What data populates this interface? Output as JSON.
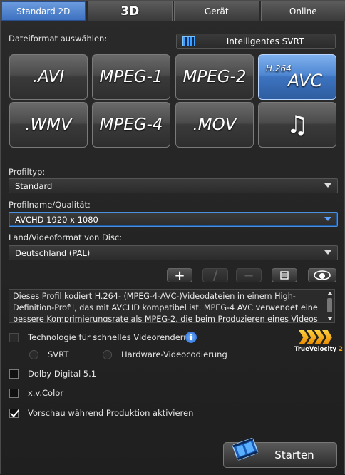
{
  "tabs": [
    {
      "label": "Standard 2D",
      "active": true
    },
    {
      "label": "3D",
      "active": false
    },
    {
      "label": "Gerät",
      "active": false
    },
    {
      "label": "Online",
      "active": false
    }
  ],
  "file_format": {
    "label": "Dateiformat auswählen:",
    "svrt_button": "Intelligentes SVRT",
    "formats": [
      {
        "label": ".AVI",
        "selected": false
      },
      {
        "label": "MPEG-1",
        "selected": false
      },
      {
        "label": "MPEG-2",
        "selected": false
      },
      {
        "label": "AVC",
        "sup": "H.264",
        "selected": true
      },
      {
        "label": ".WMV",
        "selected": false
      },
      {
        "label": "MPEG-4",
        "selected": false
      },
      {
        "label": ".MOV",
        "selected": false
      },
      {
        "label": "♫",
        "icon": "music-notes-icon",
        "selected": false
      }
    ]
  },
  "profile_type": {
    "label": "Profiltyp:",
    "value": "Standard"
  },
  "profile_name": {
    "label": "Profilname/Qualität:",
    "value": "AVCHD 1920 x 1080"
  },
  "disc_format": {
    "label": "Land/Videoformat von Disc:",
    "value": "Deutschland (PAL)"
  },
  "profile_toolbar": {
    "add": "+",
    "edit": "/",
    "remove": "−"
  },
  "description": "Dieses Profil kodiert H.264- (MPEG-4-AVC-)Videodateien in einem High-Definition-Profil, das mit AVCHD kompatibel ist. MPEG-4 AVC verwendet eine bessere Komprimierungsrate als MPEG-2, die beim Produzieren eines Videos",
  "options": {
    "fast_render": {
      "label": "Technologie für schnelles Videorendern:",
      "checked": false,
      "enabled": false
    },
    "svrt": {
      "label": "SVRT"
    },
    "hw_encoding": {
      "label": "Hardware-Videocodierung"
    },
    "dolby": {
      "label": "Dolby Digital 5.1",
      "checked": false
    },
    "xvcolor": {
      "label": "x.v.Color",
      "checked": false
    },
    "preview": {
      "label": "Vorschau während Produktion aktivieren",
      "checked": true
    }
  },
  "logo": {
    "brand_a": "True",
    "brand_b": "Velocity",
    "brand_c": "2"
  },
  "start_button": "Starten",
  "colors": {
    "accent": "#3b6fbf",
    "selected_format": "#4f87d2",
    "logo": "#f2a600"
  }
}
